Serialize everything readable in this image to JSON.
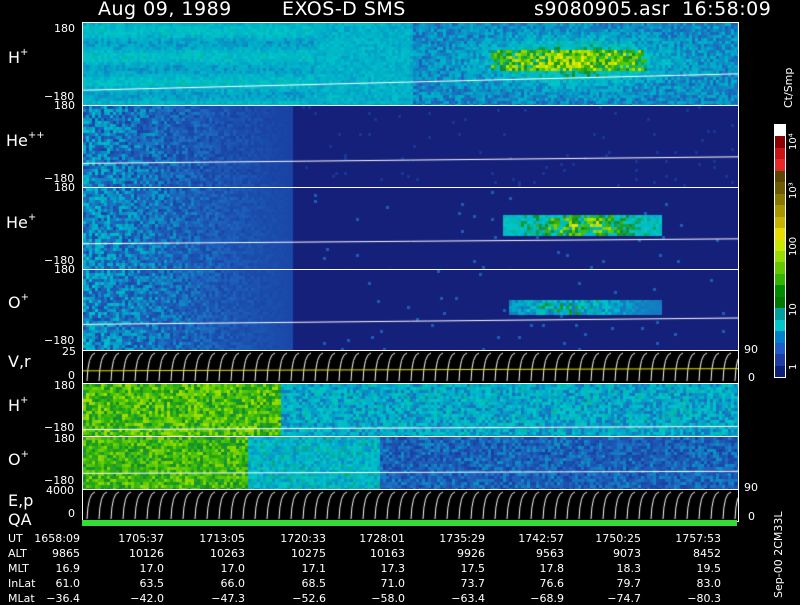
{
  "header": {
    "date": "Aug 09, 1989",
    "instrument": "EXOS-D SMS",
    "file": "s9080905.asr",
    "time": "16:58:09"
  },
  "panels": [
    {
      "id": "h-plus",
      "name": "H",
      "sup": "+",
      "ytop": "180",
      "ybot": "−180"
    },
    {
      "id": "he-plusplus",
      "name": "He",
      "sup": "++",
      "ytop": "180",
      "ybot": "−180"
    },
    {
      "id": "he-plus",
      "name": "He",
      "sup": "+",
      "ytop": "180",
      "ybot": "−180"
    },
    {
      "id": "o-plus",
      "name": "O",
      "sup": "+",
      "ytop": "180",
      "ybot": "−180"
    },
    {
      "id": "vr",
      "name": "V,r",
      "sup": "",
      "ytop": "25",
      "ybot": "0",
      "right_top": "90",
      "right_bot": "0"
    },
    {
      "id": "h-plus-2",
      "name": "H",
      "sup": "+",
      "ytop": "180",
      "ybot": "−180"
    },
    {
      "id": "o-plus-2",
      "name": "O",
      "sup": "+",
      "ytop": "180",
      "ybot": "−180"
    },
    {
      "id": "ep",
      "name": "E,p",
      "sup": "",
      "ytop": "4000",
      "ybot": "0",
      "right_top": "90",
      "right_bot": "0"
    },
    {
      "id": "qa",
      "name": "QA",
      "sup": ""
    }
  ],
  "colorbar": {
    "unit": "Ct/Smp",
    "labels": [
      "10⁴",
      "10³",
      "100",
      "10",
      "1"
    ],
    "colors": [
      "#ffffff",
      "#8b0000",
      "#c81414",
      "#e62828",
      "#5a4600",
      "#6e5a00",
      "#887800",
      "#a89600",
      "#c8b400",
      "#e6dc00",
      "#c8e600",
      "#96dc00",
      "#64c800",
      "#32b400",
      "#008c00",
      "#007800",
      "#00a0a0",
      "#00c8c8",
      "#0080c8",
      "#1e5ac8",
      "#1e3ca0",
      "#0a1e78"
    ]
  },
  "side_label": "Sep-00  2CM33L",
  "footer": {
    "row_labels": [
      "UT",
      "ALT",
      "MLT",
      "InLat",
      "MLat"
    ],
    "columns": [
      [
        "1658:09",
        "9865",
        "16.9",
        "61.0",
        "−36.4"
      ],
      [
        "1705:37",
        "10126",
        "17.0",
        "63.5",
        "−42.0"
      ],
      [
        "1713:05",
        "10263",
        "17.0",
        "66.0",
        "−47.3"
      ],
      [
        "1720:33",
        "10275",
        "17.1",
        "68.5",
        "−52.6"
      ],
      [
        "1728:01",
        "10163",
        "17.3",
        "71.0",
        "−58.0"
      ],
      [
        "1735:29",
        "9926",
        "17.5",
        "73.7",
        "−63.4"
      ],
      [
        "1742:57",
        "9563",
        "17.8",
        "76.6",
        "−68.9"
      ],
      [
        "1750:25",
        "9073",
        "18.3",
        "79.7",
        "−74.7"
      ],
      [
        "1757:53",
        "8452",
        "19.5",
        "83.0",
        "−80.3"
      ]
    ]
  },
  "chart_data": {
    "type": "heatmap",
    "title": "Aug 09, 1989   EXOS-D SMS",
    "x": [
      "1658:09",
      "1705:37",
      "1713:05",
      "1720:33",
      "1728:01",
      "1735:29",
      "1742:57",
      "1750:25",
      "1757:53"
    ],
    "series": [
      {
        "name": "H+",
        "ylim": [
          -180,
          180
        ]
      },
      {
        "name": "He++",
        "ylim": [
          -180,
          180
        ]
      },
      {
        "name": "He+",
        "ylim": [
          -180,
          180
        ]
      },
      {
        "name": "O+",
        "ylim": [
          -180,
          180
        ]
      },
      {
        "name": "V,r",
        "ylim": [
          0,
          25
        ],
        "right_ylim": [
          0,
          90
        ]
      },
      {
        "name": "H+",
        "ylim": [
          -180,
          180
        ]
      },
      {
        "name": "O+",
        "ylim": [
          -180,
          180
        ]
      },
      {
        "name": "E,p",
        "ylim": [
          0,
          4000
        ],
        "right_ylim": [
          0,
          90
        ]
      }
    ],
    "colorbar_unit": "Ct/Smp",
    "colorbar_range": [
      1,
      10000
    ],
    "log_scale": true
  }
}
